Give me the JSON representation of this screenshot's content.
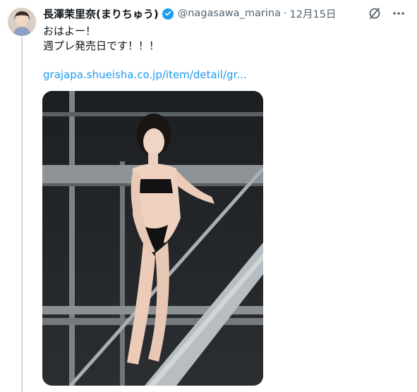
{
  "tweet": {
    "author_name": "長澤茉里奈(まりちゅう)",
    "handle": "@nagasawa_marina",
    "separator": "·",
    "date": "12月15日",
    "text_line1": "おはよー！",
    "text_line2": "週プレ発売日です！！！",
    "link_text": "grajapa.shueisha.co.jp/item/detail/gr..."
  },
  "icons": {
    "verified": "verified-badge-icon",
    "grok": "grok-icon",
    "more": "more-icon"
  },
  "colors": {
    "link": "#1d9bf0",
    "verified": "#1d9bf0",
    "thread_line": "#cfd9de",
    "muted_text": "#536471"
  }
}
